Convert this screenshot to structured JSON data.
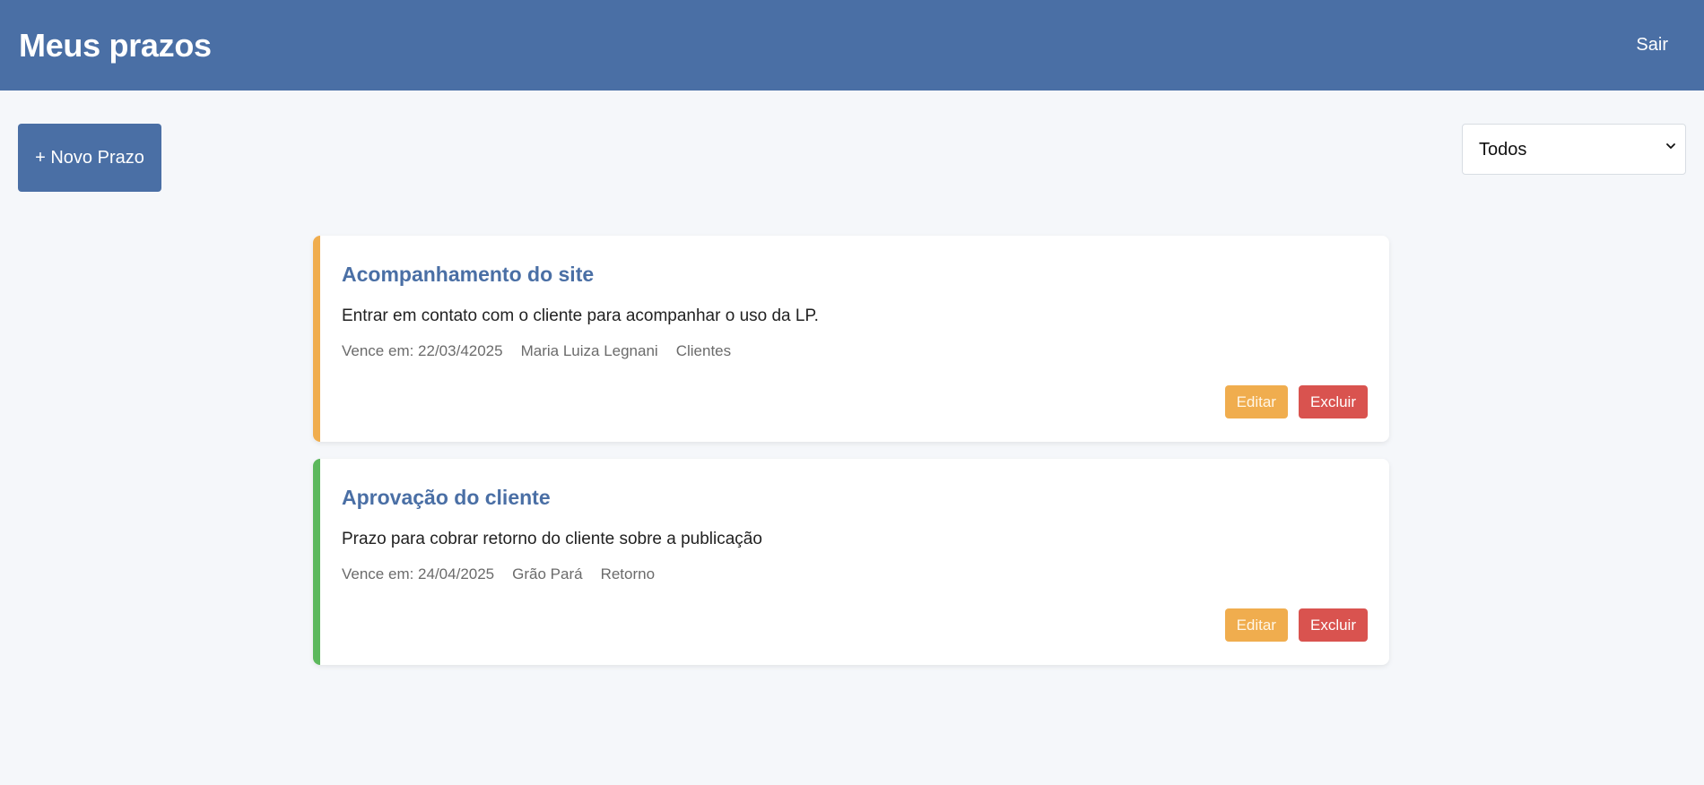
{
  "header": {
    "title": "Meus prazos",
    "logout_label": "Sair"
  },
  "toolbar": {
    "new_label": "+ Novo Prazo",
    "filter_selected": "Todos"
  },
  "colors": {
    "primary": "#4a6fa5",
    "warning": "#f0ad4e",
    "success": "#5cb85c",
    "danger": "#d9534f"
  },
  "deadlines": [
    {
      "title": "Acompanhamento do site",
      "description": "Entrar em contato com o cliente para acompanhar o uso da LP.",
      "due": "Vence em: 22/03/42025",
      "person": "Maria Luiza Legnani",
      "category": "Clientes",
      "accent": "#f0ad4e",
      "edit_label": "Editar",
      "delete_label": "Excluir"
    },
    {
      "title": "Aprovação do cliente",
      "description": "Prazo para cobrar retorno do cliente sobre a publicação",
      "due": "Vence em: 24/04/2025",
      "person": "Grão Pará",
      "category": "Retorno",
      "accent": "#5cb85c",
      "edit_label": "Editar",
      "delete_label": "Excluir"
    }
  ]
}
